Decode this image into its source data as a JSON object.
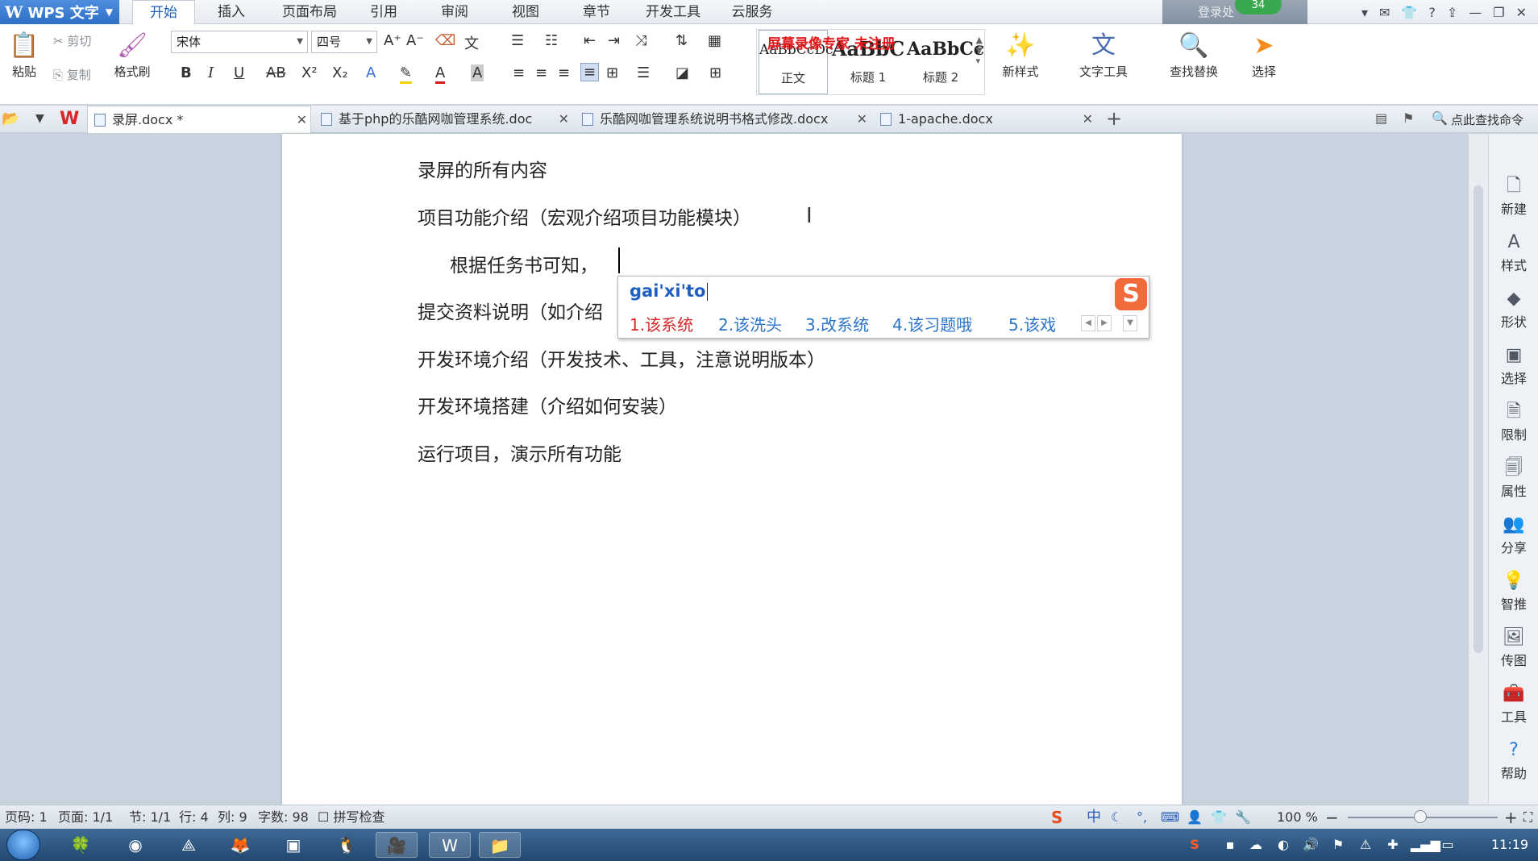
{
  "app": {
    "title": "WPS 文字"
  },
  "menu": {
    "tabs": [
      "开始",
      "插入",
      "页面布局",
      "引用",
      "审阅",
      "视图",
      "章节",
      "开发工具",
      "云服务"
    ],
    "login_text": "登录处",
    "badge": "34"
  },
  "ribbon": {
    "paste": "粘贴",
    "cut": "剪切",
    "copy": "复制",
    "format_painter": "格式刷",
    "font_name": "宋体",
    "font_size": "四号",
    "styles": [
      {
        "preview": "AaBbCcDc",
        "label": "正文"
      },
      {
        "preview": "AaBbC",
        "label": "标题 1"
      },
      {
        "preview": "AaBbCc",
        "label": "标题 2"
      }
    ],
    "trial_banner": "屏幕录像专家  未注册",
    "new_style": "新样式",
    "text_tools": "文字工具",
    "find_replace": "查找替换",
    "select": "选择"
  },
  "doc_tabs": [
    {
      "label": "录屏.docx *",
      "active": true
    },
    {
      "label": "基于php的乐酷网咖管理系统.doc",
      "active": false
    },
    {
      "label": "乐酷网咖管理系统说明书格式修改.docx",
      "active": false
    },
    {
      "label": "1-apache.docx",
      "active": false
    }
  ],
  "tabbar": {
    "command_search": "点此查找命令"
  },
  "document": {
    "paragraphs": [
      "录屏的所有内容",
      "项目功能介绍（宏观介绍项目功能模块）",
      "根据任务书可知，",
      "提交资料说明（如介绍",
      "开发环境介绍（开发技术、工具，注意说明版本）",
      "开发环境搭建（介绍如何安装）",
      "运行项目，演示所有功能"
    ]
  },
  "ime": {
    "input": "gai'xi'to",
    "candidates": [
      "1.该系统",
      "2.该洗头",
      "3.改系统",
      "4.该习题哦",
      "5.该戏"
    ]
  },
  "side_panel": [
    "新建",
    "样式",
    "形状",
    "选择",
    "限制",
    "属性",
    "分享",
    "智推",
    "传图",
    "工具",
    "帮助"
  ],
  "status": {
    "page_code": "页码: 1",
    "pages": "页面: 1/1",
    "section": "节: 1/1",
    "line": "行: 4",
    "column": "列: 9",
    "word_count": "字数: 98",
    "spell_check": "拼写检查",
    "zoom": "100 %"
  },
  "taskbar": {
    "time": "11:19"
  }
}
